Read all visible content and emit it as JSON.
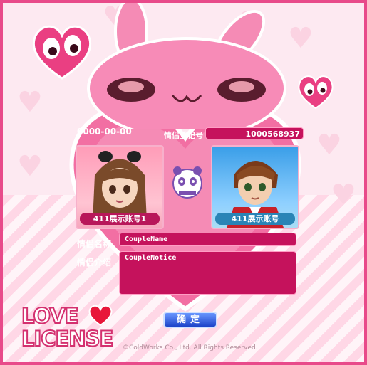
{
  "certificate": {
    "date": "0000-00-00",
    "registration_label": "情侣登记号",
    "registration_number": "1000568937"
  },
  "avatars": {
    "left_name": "411展示账号1",
    "right_name": "411展示账号"
  },
  "fields": {
    "name_label": "情侣名称",
    "name_value": "CoupleName",
    "intro_label": "情侣介绍",
    "intro_value": "CoupleNotice"
  },
  "actions": {
    "confirm_label": "确定"
  },
  "branding": {
    "logo_line1": "LOVE",
    "logo_line2": "LICENSE",
    "copyright": "©ColdWorks Co., Ltd. All Rights Reserved."
  },
  "colors": {
    "frame": "#e84a8a",
    "field_bg": "#c5125c",
    "confirm_button": "#2a5ae0"
  }
}
